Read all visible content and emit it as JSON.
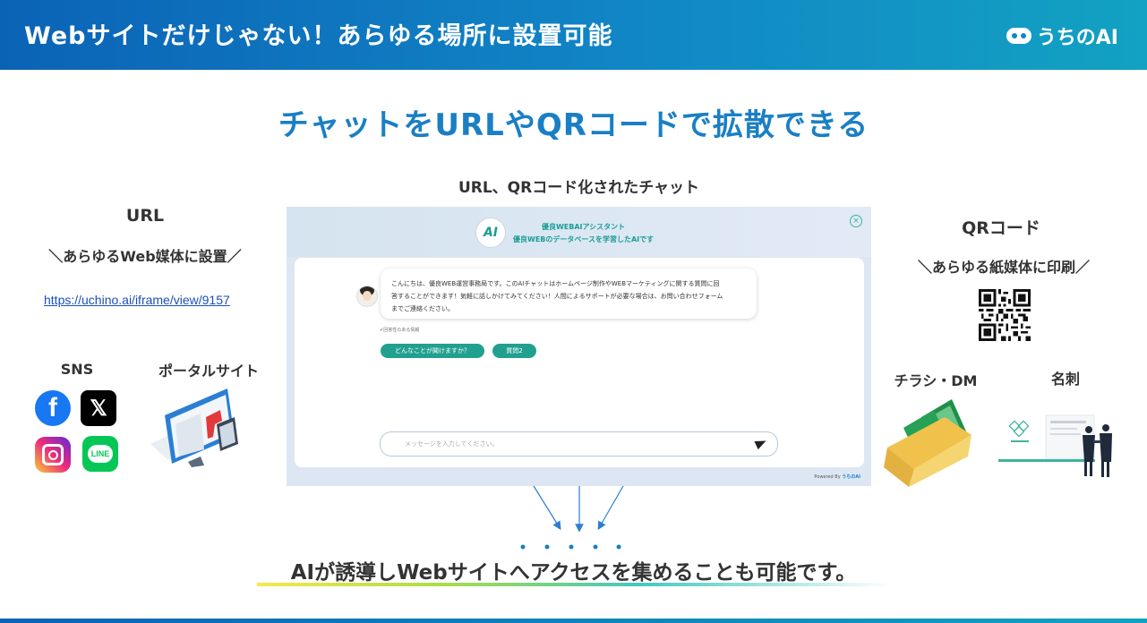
{
  "header": {
    "title": "Webサイトだけじゃない！あらゆる場所に設置可能",
    "brand": "うちのAI"
  },
  "main_heading": "チャットをURLやQRコードで拡散できる",
  "chat_caption": "URL、QRコード化されたチャット",
  "left": {
    "title": "URL",
    "subtitle": "＼あらゆるWeb媒体に設置／",
    "link": "https://uchino.ai/iframe/view/9157",
    "sns_label": "SNS",
    "portal_label": "ポータルサイト",
    "sns_icons": [
      "facebook-icon",
      "x-icon",
      "instagram-icon",
      "line-icon"
    ],
    "line_text": "LINE"
  },
  "right": {
    "title": "QRコード",
    "subtitle": "＼あらゆる紙媒体に印刷／",
    "flyer_label": "チラシ・DM",
    "card_label": "名刺"
  },
  "chat": {
    "badge": "AI",
    "name_line1": "優良WEBAIアシスタント",
    "name_line2": "優良WEBのデータベースを学習したAIです",
    "close": "×",
    "message_line1": "こんにちは、優良WEB運営事務局です。このAIチャットはホームページ制作やWEBマーケティングに関する質問に回",
    "message_line2": "答することができます！気軽に話しかけてみてください！人間によるサポートが必要な場合は、お問い合わせフォーム",
    "message_line3": "までご連絡ください。",
    "note": "✔回答性のある情報",
    "chips": [
      "どんなことが聞けますか？",
      "質問2"
    ],
    "input_placeholder": "メッセージを入力してください。",
    "powered_prefix": "Powered By",
    "powered_brand": "うちのAI"
  },
  "bottom_text": "AIが誘導しWebサイトへアクセスを集めることも可能です。",
  "colors": {
    "primary": "#1a7fc4",
    "header_start": "#0b63b6",
    "header_end": "#12a2c2",
    "chat_accent": "#21a08f"
  }
}
